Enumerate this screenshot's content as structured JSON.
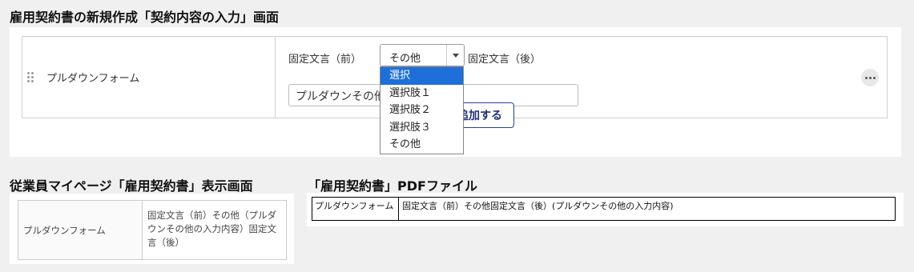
{
  "headings": {
    "create": "雇用契約書の新規作成「契約内容の入力」画面",
    "mypage": "従業員マイページ「雇用契約書」表示画面",
    "pdf": "「雇用契約書」PDFファイル"
  },
  "form": {
    "field_label": "プルダウンフォーム",
    "fixed_before": "固定文言（前）",
    "fixed_after": "固定文言（後）",
    "selected": "その他",
    "text_value": "プルダウンその他",
    "add_button": "追加する",
    "options": [
      "選択",
      "選択肢１",
      "選択肢２",
      "選択肢３",
      "その他"
    ],
    "highlighted_option": "選択"
  },
  "mypage_table": {
    "label": "プルダウンフォーム",
    "value": "固定文言（前）その他（プルダウンその他の入力内容）固定文言（後）"
  },
  "pdf_table": {
    "label": "プルダウンフォーム",
    "value": "固定文言（前）その他固定文言（後）(プルダウンその他の入力内容)"
  },
  "colors": {
    "highlight": "#1e6fd9",
    "button_border": "#2a3f8f"
  }
}
